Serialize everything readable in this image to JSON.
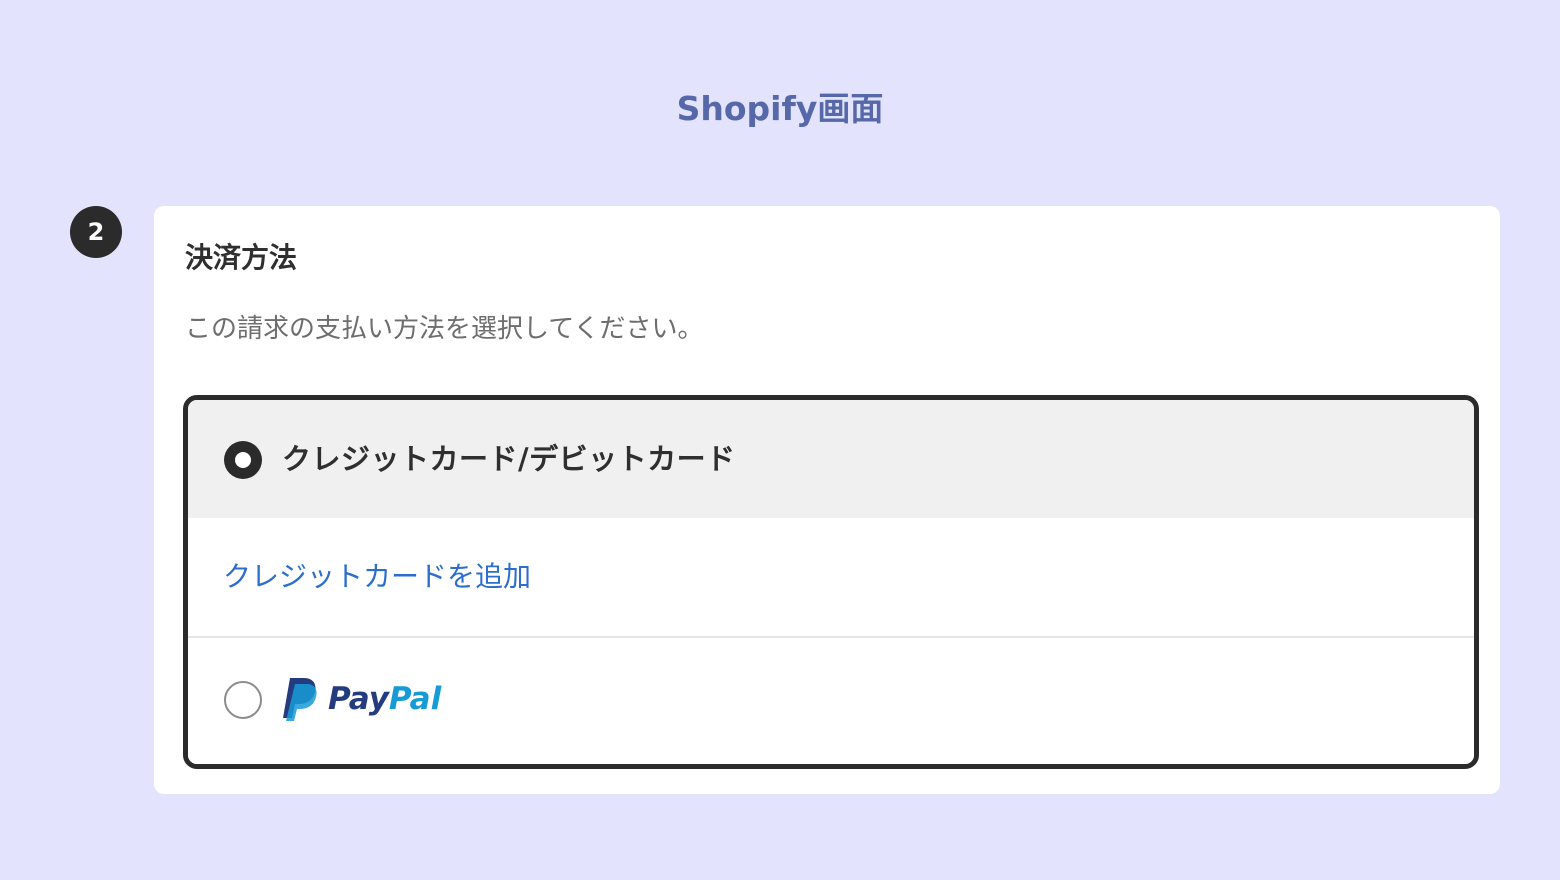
{
  "page": {
    "title": "Shopify画面"
  },
  "step": {
    "number": "2"
  },
  "payment_card": {
    "heading": "決済方法",
    "description": "この請求の支払い方法を選択してください。",
    "options": [
      {
        "label": "クレジットカード/デビットカード",
        "selected": true,
        "add_link": "クレジットカードを追加"
      },
      {
        "brand_pay": "Pay",
        "brand_pal": "Pal",
        "selected": false,
        "icon": "paypal-logo"
      }
    ]
  },
  "colors": {
    "background": "#e3e3fd",
    "title": "#5668a8",
    "link": "#2c6ecb",
    "paypal_dark": "#253b80",
    "paypal_light": "#179bd7",
    "selected_row": "#f0f0f0"
  }
}
